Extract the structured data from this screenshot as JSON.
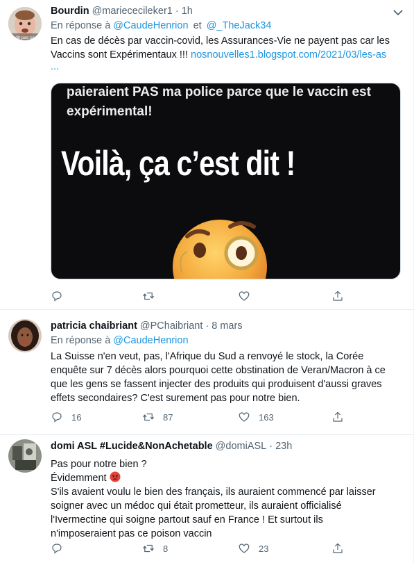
{
  "tweets": [
    {
      "name": "Bourdin",
      "handle": "@mariececileker1",
      "time": "1h",
      "reply_prefix": "En réponse à",
      "reply_mentions": [
        "@CaudeHenrion",
        "@_TheJack34"
      ],
      "reply_sep": "et",
      "text_line1": "En cas de décès par vaccin-covid, les Assurances-Vie ne payent pas car les",
      "text_line2": "Vaccins sont Expérimentaux !!!",
      "link_text": "nosnouvelles1.blogspot.com/2021/03/les-as",
      "link_ellipsis": "...",
      "media": {
        "line1": "paieraient PAS ma police parce que le vaccin est",
        "line2": "expérimental!",
        "headline": "Voilà, ça c’est dit !"
      },
      "avatar_caption": "dit pas ça",
      "counts": {
        "reply": "",
        "retweet": "",
        "like": ""
      }
    },
    {
      "name": "patricia chaibriant",
      "handle": "@PChaibriant",
      "time": "8 mars",
      "reply_prefix": "En réponse à",
      "reply_mentions": [
        "@CaudeHenrion"
      ],
      "lines": [
        "La Suisse n'en veut, pas, l'Afrique du Sud a renvoyé le stock, la Corée",
        "enquête sur 7 décès alors pourquoi cette obstination de Veran/Macron à ce",
        "que les gens se fassent injecter des produits qui produisent d'aussi graves",
        "effets secondaires? C'est surement pas pour notre bien."
      ],
      "counts": {
        "reply": "16",
        "retweet": "87",
        "like": "163"
      }
    },
    {
      "name": "domi ASL #Lucide&NonAchetable",
      "handle": "@domiASL",
      "time": "23h",
      "lines": [
        "Pas pour notre bien ?",
        "Évidemment",
        "S'ils avaient voulu le bien des français, ils auraient commencé par laisser",
        "soigner avec un médoc qui était prometteur, ils auraient officialisé",
        "l'Ivermectine qui soigne partout sauf en France ! Et surtout ils",
        "n'imposeraient pas ce poison vaccin"
      ],
      "counts": {
        "reply": "",
        "retweet": "8",
        "like": "23"
      }
    }
  ],
  "icons": {
    "reply": "reply-icon",
    "retweet": "retweet-icon",
    "like": "heart-icon",
    "share": "share-icon",
    "more": "chevron-down-icon",
    "angry": "angry-face-emoji"
  },
  "colors": {
    "link": "#1b95e0",
    "secondary": "#536471",
    "text": "#0f1419",
    "border": "#e6ecf0"
  }
}
